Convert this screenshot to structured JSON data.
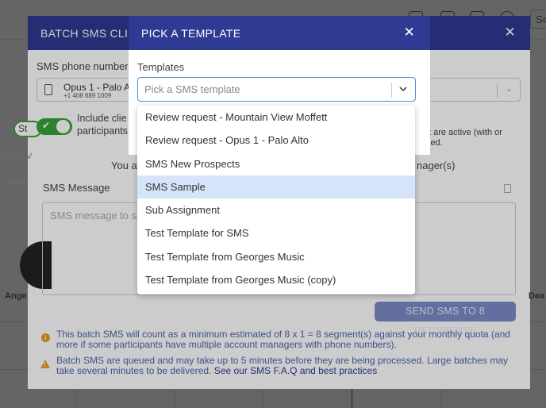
{
  "background": {
    "search_text": "Se",
    "left_toggle_label": "St",
    "filtered_text": "iltered V",
    "select_text": "o selec",
    "avatar_left_name": "Ange",
    "avatar_right_name": "Dea"
  },
  "batch_modal": {
    "title": "BATCH SMS CLIE",
    "phone_label": "SMS phone number",
    "phone_name": "Opus 1 - Palo A",
    "phone_number": "+1 408 889 1009",
    "include_label_line1": "Include clie",
    "include_label_line2": "participants",
    "active_text_line1": "t are active (with or",
    "active_text_line2": "led.",
    "you_text": "You ar",
    "manager_text": "nager(s)",
    "sms_message_label": "SMS Message",
    "message_placeholder": "SMS message to ser",
    "send_button": "SEND SMS TO 8 RECIPIENTS",
    "note_info": "This batch SMS will count as a minimum estimated of 8 x 1 = 8 segment(s) against your monthly quota (and more if some participants have multiple account managers with phone numbers).",
    "note_warning": "Batch SMS are queued and may take up to 5 minutes before they are being processed. Large batches may take several minutes to be delivered.",
    "faq_link": "See our SMS F.A.Q and best practices"
  },
  "pick_modal": {
    "title": "PICK A TEMPLATE",
    "templates_label": "Templates",
    "select_placeholder": "Pick a SMS template"
  },
  "dropdown_options": [
    "Review request - Mountain View Moffett",
    "Review request - Opus 1 - Palo Alto",
    "SMS New Prospects",
    "SMS Sample",
    "Sub Assignment",
    "Test Template for SMS",
    "Test Template from Georges Music",
    "Test Template from Georges Music (copy)"
  ],
  "highlighted_option": "SMS Sample",
  "colors": {
    "header_blue": "#2f3a93",
    "toggle_green": "#3aa33a",
    "highlight": "#d6e4fb",
    "focus_border": "#4a90d9"
  }
}
